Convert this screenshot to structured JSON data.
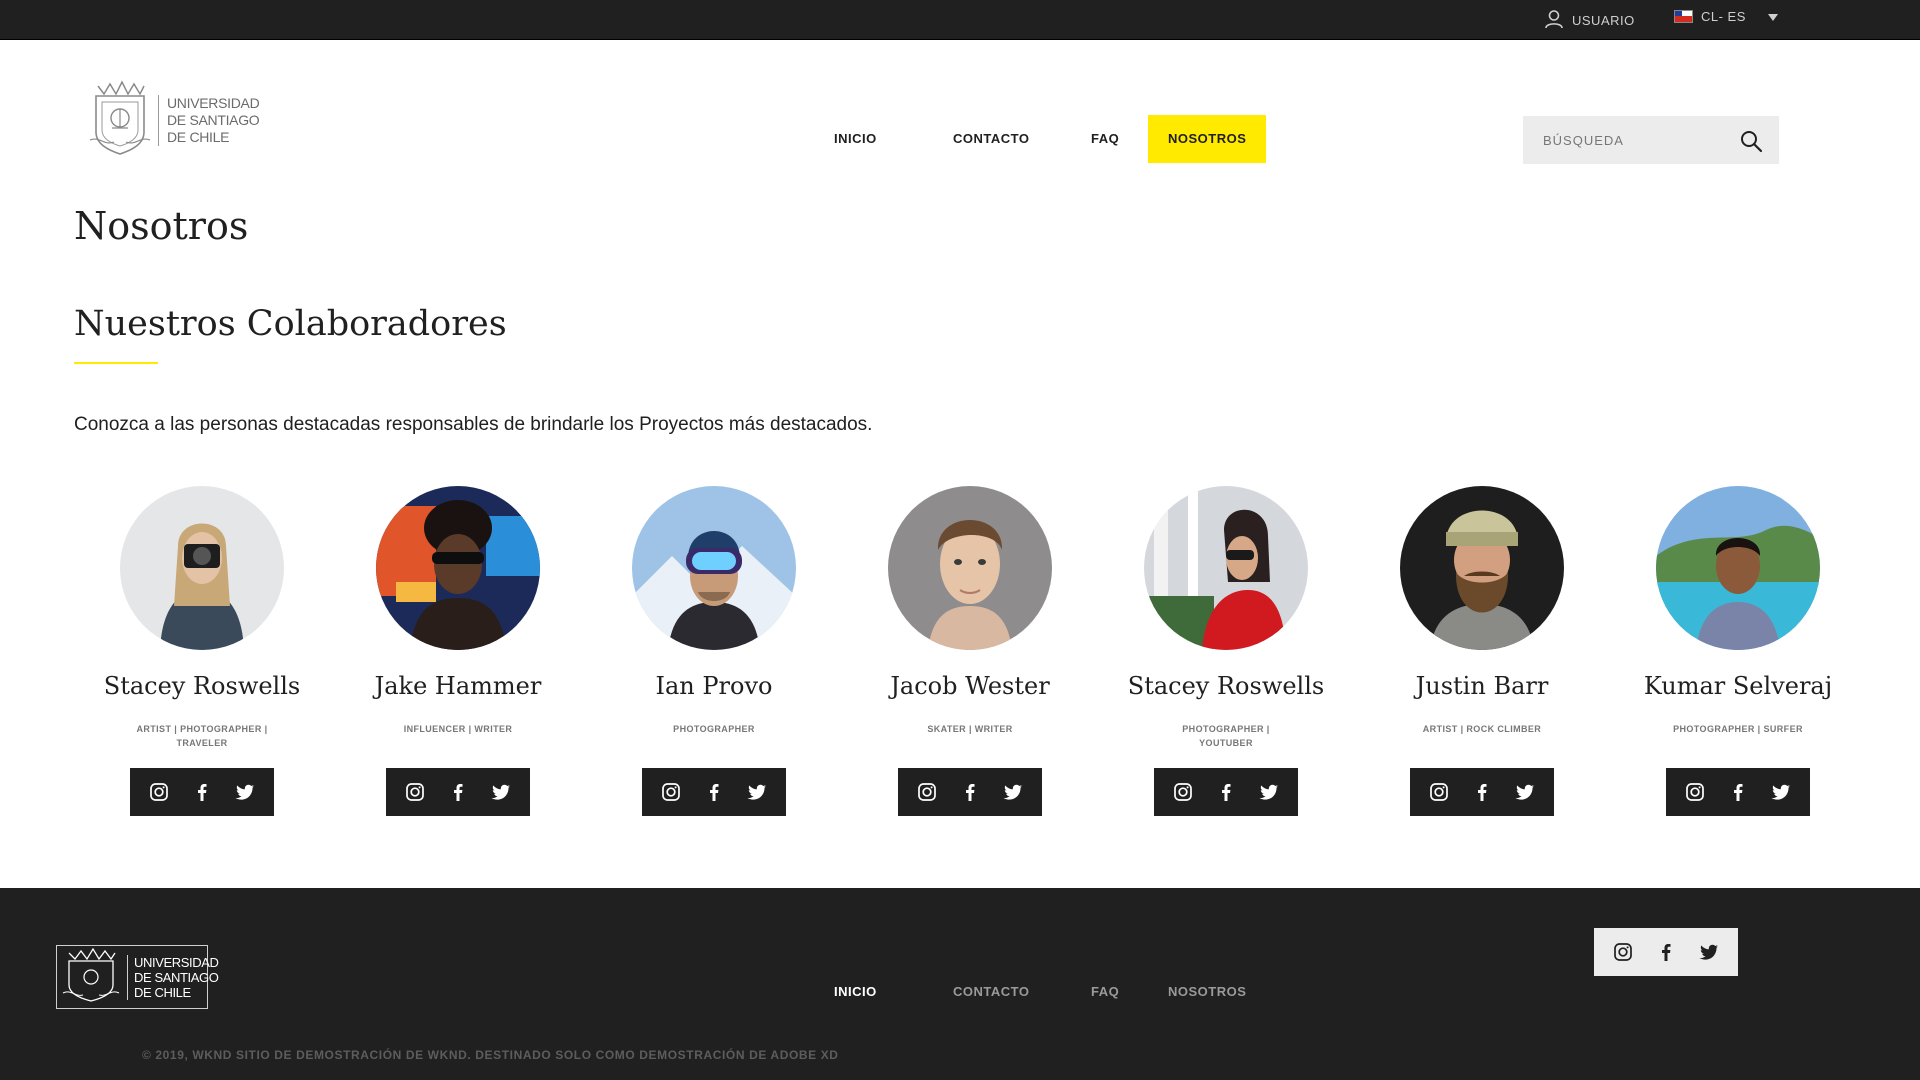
{
  "topbar": {
    "user_label": "USUARIO",
    "lang_label": "CL- ES",
    "icons": {
      "user": "user-icon",
      "flag": "chile-flag-icon",
      "dropdown": "caret-down-icon"
    }
  },
  "header": {
    "logo_lines": [
      "UNIVERSIDAD",
      "DE SANTIAGO",
      "DE CHILE"
    ],
    "nav": [
      "INICIO",
      "CONTACTO",
      "FAQ",
      "NOSOTROS"
    ],
    "active_nav": "NOSOTROS",
    "search_placeholder": "BÚSQUEDA",
    "accent_color": "#ffea00"
  },
  "main": {
    "page_title": "Nosotros",
    "section_title": "Nuestros Colaboradores",
    "intro": "Conozca a las personas destacadas responsables de brindarle los Proyectos más destacados.",
    "members": [
      {
        "name": "Stacey Roswells",
        "role": "ARTIST | PHOTOGRAPHER | TRAVELER"
      },
      {
        "name": "Jake Hammer",
        "role": "INFLUENCER | WRITER"
      },
      {
        "name": "Ian Provo",
        "role": "PHOTOGRAPHER"
      },
      {
        "name": "Jacob Wester",
        "role": "SKATER | WRITER"
      },
      {
        "name": "Stacey Roswells",
        "role": "PHOTOGRAPHER | YOUTUBER"
      },
      {
        "name": "Justin Barr",
        "role": "ARTIST | ROCK CLIMBER"
      },
      {
        "name": "Kumar Selveraj",
        "role": "PHOTOGRAPHER | SURFER"
      }
    ],
    "social_icons": [
      "instagram-icon",
      "facebook-icon",
      "twitter-icon"
    ]
  },
  "footer": {
    "logo_lines": [
      "UNIVERSIDAD",
      "DE SANTIAGO",
      "DE CHILE"
    ],
    "nav": [
      "INICIO",
      "CONTACTO",
      "FAQ",
      "NOSOTROS"
    ],
    "active_nav": "INICIO",
    "copyright": "© 2019, WKND SITIO DE DEMOSTRACIÓN DE WKND. DESTINADO SOLO COMO DEMOSTRACIÓN DE ADOBE XD"
  }
}
